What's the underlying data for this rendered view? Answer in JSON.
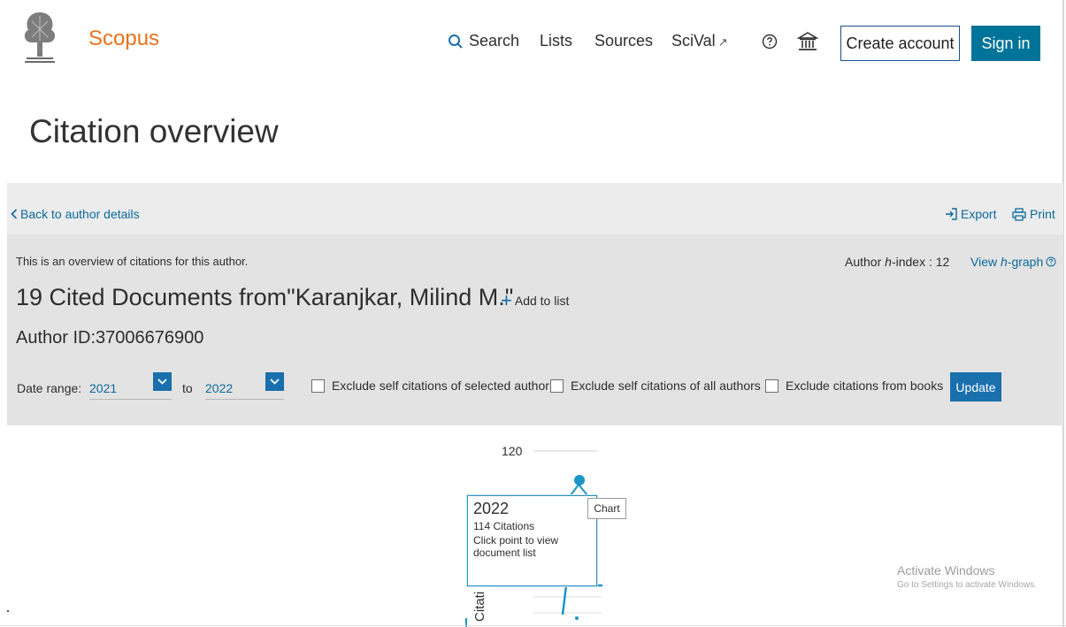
{
  "header": {
    "brand": "Scopus",
    "nav": {
      "search": "Search",
      "lists": "Lists",
      "sources": "Sources",
      "scival": "SciVal",
      "scival_ext": "↗"
    },
    "create_account": "Create account",
    "sign_in": "Sign in"
  },
  "page_title": "Citation overview",
  "toolbar": {
    "back": "Back to author details",
    "export": "Export",
    "print": "Print"
  },
  "summary": {
    "overview_text": "This is an overview of citations for this author.",
    "hindex_prefix": "Author ",
    "hindex_h": "h",
    "hindex_suffix": "-index : 12",
    "view_prefix": "View ",
    "view_h": "h",
    "view_suffix": "-graph",
    "heading": "19 Cited Documents from\"Karanjkar, Milind M.\"",
    "add_to_list": "Add to list",
    "author_id": "Author ID:37006676900"
  },
  "filters": {
    "date_range_label": "Date range:",
    "from": "2021",
    "to_label": "to",
    "to": "2022",
    "exclude_self_selected": "Exclude self citations of selected author",
    "exclude_self_all": "Exclude self citations of all authors",
    "exclude_books": "Exclude citations from books",
    "update": "Update"
  },
  "chart_data": {
    "type": "line",
    "x": [
      2022
    ],
    "values": [
      114
    ],
    "y_tick": "120",
    "y_label_fragment": "Citati",
    "tooltip": {
      "year": "2022",
      "citations": "114 Citations",
      "hint": "Click point to view document list"
    },
    "tag": "Chart"
  },
  "watermark": {
    "line1": "Activate Windows",
    "line2": "Go to Settings to activate Windows."
  },
  "colors": {
    "brand": "#e9711c",
    "link": "#0b6a9b",
    "primary": "#007398",
    "accent": "#1a6fad",
    "chart_line": "#1b95c8"
  }
}
